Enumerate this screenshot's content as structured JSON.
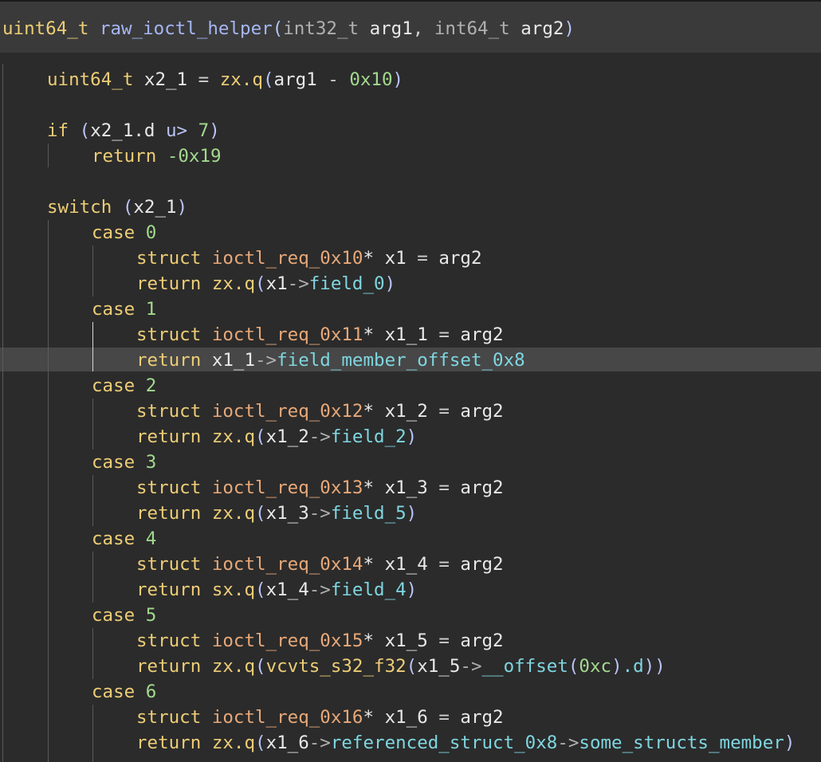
{
  "signature": {
    "return_type": "uint64_t",
    "name": "raw_ioctl_helper",
    "open_paren": "(",
    "param1_type": "int32_t",
    "param1_name": "arg1",
    "comma": ",",
    "param2_type": "int64_t",
    "param2_name": "arg2",
    "close_paren": ")"
  },
  "lines": {
    "l1": {
      "type": "uint64_t",
      "var": "x2_1",
      "eq": "=",
      "fn": "zx.q",
      "op": "(",
      "a": "arg1",
      "minus": "-",
      "num": "0x10",
      "cp": ")"
    },
    "l2": {
      "kw": "if",
      "op": "(",
      "a": "x2_1.d",
      "cmp": "u>",
      "num": "7",
      "cp": ")"
    },
    "l3": {
      "kw": "return",
      "num": "-0x19"
    },
    "l4": {
      "kw": "switch",
      "op": "(",
      "a": "x2_1",
      "cp": ")"
    },
    "c0": {
      "kw": "case",
      "num": "0"
    },
    "c0a": {
      "kw": "struct",
      "st": "ioctl_req_0x10",
      "ptr": "*",
      "var": "x1",
      "eq": "=",
      "v": "arg2"
    },
    "c0b": {
      "kw": "return",
      "fn": "zx.q",
      "op": "(",
      "a": "x1",
      "arrow": "->",
      "f": "field_0",
      "cp": ")"
    },
    "c1": {
      "kw": "case",
      "num": "1"
    },
    "c1a": {
      "kw": "struct",
      "st": "ioctl_req_0x11",
      "ptr": "*",
      "var": "x1_1",
      "eq": "=",
      "v": "arg2"
    },
    "c1b": {
      "kw": "return",
      "a": "x1_1",
      "arrow": "->",
      "f": "field_member_offset_0x8"
    },
    "c2": {
      "kw": "case",
      "num": "2"
    },
    "c2a": {
      "kw": "struct",
      "st": "ioctl_req_0x12",
      "ptr": "*",
      "var": "x1_2",
      "eq": "=",
      "v": "arg2"
    },
    "c2b": {
      "kw": "return",
      "fn": "zx.q",
      "op": "(",
      "a": "x1_2",
      "arrow": "->",
      "f": "field_2",
      "cp": ")"
    },
    "c3": {
      "kw": "case",
      "num": "3"
    },
    "c3a": {
      "kw": "struct",
      "st": "ioctl_req_0x13",
      "ptr": "*",
      "var": "x1_3",
      "eq": "=",
      "v": "arg2"
    },
    "c3b": {
      "kw": "return",
      "fn": "zx.q",
      "op": "(",
      "a": "x1_3",
      "arrow": "->",
      "f": "field_5",
      "cp": ")"
    },
    "c4": {
      "kw": "case",
      "num": "4"
    },
    "c4a": {
      "kw": "struct",
      "st": "ioctl_req_0x14",
      "ptr": "*",
      "var": "x1_4",
      "eq": "=",
      "v": "arg2"
    },
    "c4b": {
      "kw": "return",
      "fn": "sx.q",
      "op": "(",
      "a": "x1_4",
      "arrow": "->",
      "f": "field_4",
      "cp": ")"
    },
    "c5": {
      "kw": "case",
      "num": "5"
    },
    "c5a": {
      "kw": "struct",
      "st": "ioctl_req_0x15",
      "ptr": "*",
      "var": "x1_5",
      "eq": "=",
      "v": "arg2"
    },
    "c5b": {
      "kw": "return",
      "fn": "zx.q",
      "op": "(",
      "fn2": "vcvts_s32_f32",
      "op2": "(",
      "a": "x1_5",
      "arrow": "->",
      "f": "__offset",
      "op3": "(",
      "num": "0xc",
      "cp3": ")",
      "d": ".d",
      "cp2": ")",
      "cp": ")"
    },
    "c6": {
      "kw": "case",
      "num": "6"
    },
    "c6a": {
      "kw": "struct",
      "st": "ioctl_req_0x16",
      "ptr": "*",
      "var": "x1_6",
      "eq": "=",
      "v": "arg2"
    },
    "c6b": {
      "kw": "return",
      "fn": "zx.q",
      "op": "(",
      "a": "x1_6",
      "arrow": "->",
      "f": "referenced_struct_0x8",
      "arrow2": "->",
      "f2": "some_structs_member",
      "cp": ")"
    }
  }
}
